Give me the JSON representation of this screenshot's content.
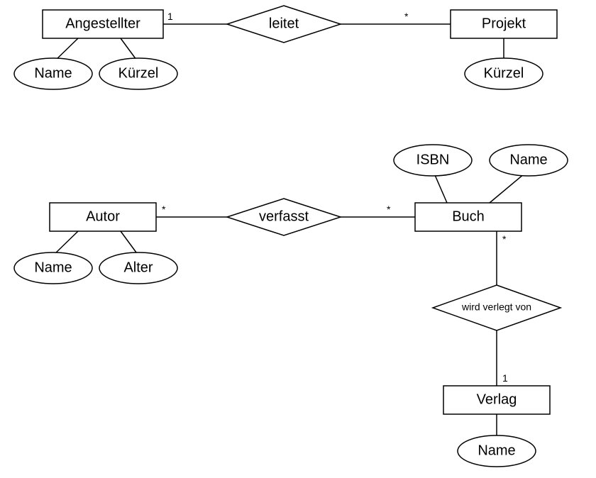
{
  "entities": {
    "angestellter": {
      "label": "Angestellter"
    },
    "projekt": {
      "label": "Projekt"
    },
    "autor": {
      "label": "Autor"
    },
    "buch": {
      "label": "Buch"
    },
    "verlag": {
      "label": "Verlag"
    }
  },
  "relationships": {
    "leitet": {
      "label": "leitet"
    },
    "verfasst": {
      "label": "verfasst"
    },
    "verlegtVon": {
      "label": "wird verlegt von"
    }
  },
  "attributes": {
    "angestellter_name": {
      "label": "Name"
    },
    "angestellter_kuerzel": {
      "label": "Kürzel"
    },
    "projekt_kuerzel": {
      "label": "Kürzel"
    },
    "autor_name": {
      "label": "Name"
    },
    "autor_alter": {
      "label": "Alter"
    },
    "buch_isbn": {
      "label": "ISBN"
    },
    "buch_name": {
      "label": "Name"
    },
    "verlag_name": {
      "label": "Name"
    }
  },
  "cardinalities": {
    "angestellter_leitet": "1",
    "projekt_leitet": "*",
    "autor_verfasst": "*",
    "buch_verfasst": "*",
    "buch_verlegtVon": "*",
    "verlag_verlegtVon": "1"
  }
}
